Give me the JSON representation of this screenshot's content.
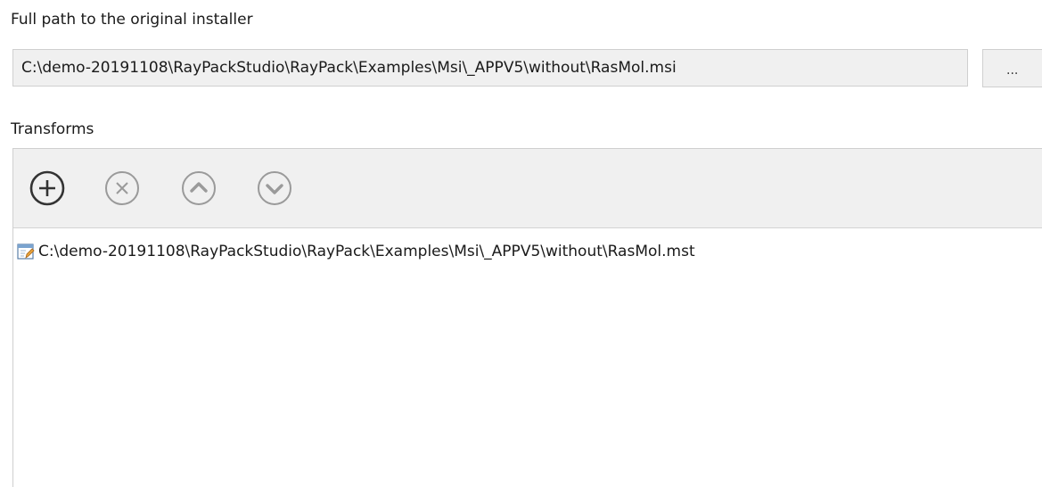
{
  "installer": {
    "label": "Full path to the original installer",
    "path": "C:\\demo-20191108\\RayPackStudio\\RayPack\\Examples\\Msi\\_APPV5\\without\\RasMol.msi",
    "browse_label": "..."
  },
  "transforms": {
    "label": "Transforms",
    "toolbar": {
      "add_icon": "add-circle-icon",
      "remove_icon": "remove-circle-icon",
      "move_up_icon": "move-up-circle-icon",
      "move_down_icon": "move-down-circle-icon"
    },
    "items": [
      {
        "icon": "transform-file-icon",
        "path": "C:\\demo-20191108\\RayPackStudio\\RayPack\\Examples\\Msi\\_APPV5\\without\\RasMol.mst"
      }
    ]
  },
  "colors": {
    "enabled_icon": "#333333",
    "disabled_icon": "#9a9a9a",
    "field_background": "#f0f0f0",
    "border": "#cfcfcf"
  }
}
